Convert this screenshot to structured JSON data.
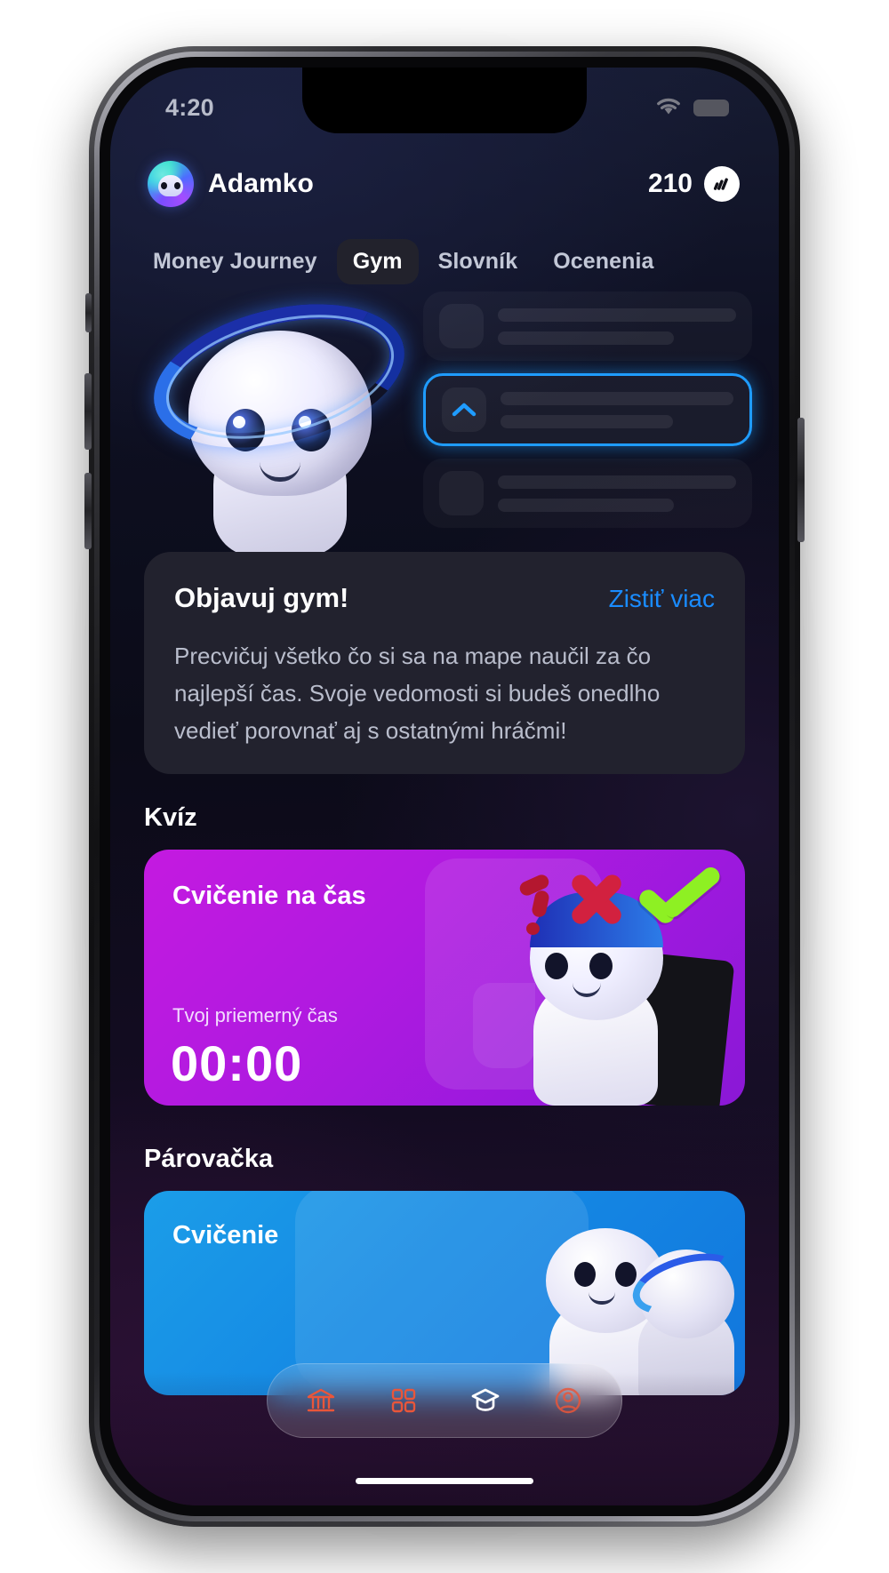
{
  "status_bar": {
    "time": "4:20",
    "wifi_icon": "wifi-icon",
    "battery_icon": "battery-icon"
  },
  "header": {
    "avatar_name": "avatar",
    "username": "Adamko",
    "coins_value": "210",
    "coins_icon": "coin-badge-icon"
  },
  "tabs": [
    {
      "label": "Money Journey",
      "active": false
    },
    {
      "label": "Gym",
      "active": true
    },
    {
      "label": "Slovník",
      "active": false
    },
    {
      "label": "Ocenenia",
      "active": false
    }
  ],
  "hero": {
    "mascot_icon": "mascot-avatar",
    "skeleton_rows": [
      {
        "state": "placeholder"
      },
      {
        "state": "highlighted",
        "icon": "chevron-up-icon"
      },
      {
        "state": "placeholder"
      }
    ]
  },
  "info_card": {
    "title": "Objavuj gym!",
    "link": "Zistiť viac",
    "body": "Precvičuj všetko čo si sa na mape naučil za čo najlepší čas. Svoje vedomosti si budeš onedlho vedieť porovnať aj s ostatnými hráčmi!"
  },
  "sections": {
    "quiz_title": "Kvíz",
    "pair_title": "Párovačka"
  },
  "quiz_card": {
    "title": "Cvičenie na čas",
    "subtitle": "Tvoj priemerný čas",
    "time": "00:00",
    "accent_color": "#b01ae0"
  },
  "pair_card": {
    "title": "Cvičenie",
    "accent_color": "#1589e4"
  },
  "tabbar": {
    "items": [
      {
        "icon": "bank-icon",
        "active": false
      },
      {
        "icon": "grid-icon",
        "active": false
      },
      {
        "icon": "graduation-cap-icon",
        "active": true
      },
      {
        "icon": "profile-icon",
        "active": false
      }
    ]
  }
}
